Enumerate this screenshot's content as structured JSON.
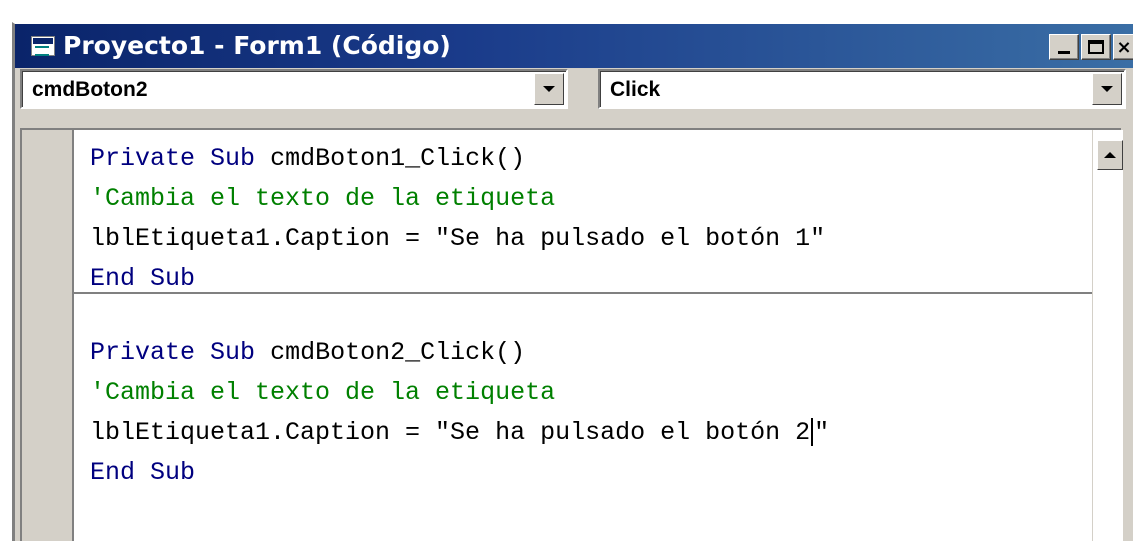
{
  "window": {
    "title": "Proyecto1 - Form1 (Código)",
    "controls": {
      "minimize": "_",
      "maximize": "□",
      "close": "×"
    }
  },
  "combos": {
    "object": {
      "value": "cmdBoton2"
    },
    "procedure": {
      "value": "Click"
    }
  },
  "code": {
    "block1": {
      "kw1": "Private",
      "kw2": "Sub",
      "signature": " cmdBoton1_Click()",
      "comment": "'Cambia el texto de la etiqueta",
      "statement": "lblEtiqueta1.Caption = \"Se ha pulsado el botón 1\"",
      "end": "End Sub"
    },
    "block2": {
      "kw1": "Private",
      "kw2": "Sub",
      "signature": " cmdBoton2_Click()",
      "comment": "'Cambia el texto de la etiqueta",
      "statement_before_caret": "lblEtiqueta1.Caption = \"Se ha pulsado el botón 2",
      "statement_after_caret": "\"",
      "end": "End Sub"
    }
  },
  "icons": {
    "app": "vb-form-icon",
    "dropdown": "chevron-down-icon",
    "scroll_up": "scroll-up-icon"
  },
  "colors": {
    "keyword": "#00007f",
    "comment": "#008000",
    "titlebar": "#0a246a"
  }
}
